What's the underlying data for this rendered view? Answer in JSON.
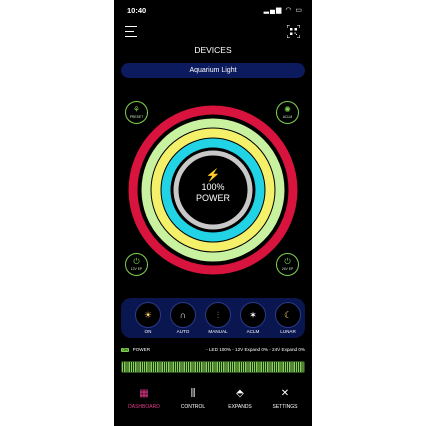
{
  "status": {
    "time": "10:40",
    "icons": "▂▄▆ ◠ ▭"
  },
  "header": {
    "title": "DEVICES",
    "device": "Aquarium Light"
  },
  "side_buttons": {
    "preset": {
      "label": "PRESET",
      "icon": "sprout-icon"
    },
    "aclm": {
      "label": "ACLM",
      "icon": "coral-icon"
    },
    "v12": {
      "label": "12V EP",
      "icon": "plug-icon"
    },
    "v24": {
      "label": "24V EP",
      "icon": "plug-icon"
    }
  },
  "center": {
    "glyph": "⚡",
    "power_value": "100%",
    "power_label": "POWER"
  },
  "rings": [
    {
      "color": "#d8133d"
    },
    {
      "color": "#c9f2a0"
    },
    {
      "color": "#f5f06a"
    },
    {
      "color": "#22d3e6"
    },
    {
      "color": "#c8c8c8"
    }
  ],
  "modes": [
    {
      "label": "ON",
      "glyph": "☀"
    },
    {
      "label": "AUTO",
      "glyph": "∩"
    },
    {
      "label": "MANUAL",
      "glyph": "⫶"
    },
    {
      "label": "ACLM",
      "glyph": "✶"
    },
    {
      "label": "LUNAR",
      "glyph": "☾"
    }
  ],
  "power_status": {
    "tag": "ON",
    "label": "POWER",
    "details": "- LED 100% - 12V Expand 0% - 24V Expand 0%"
  },
  "power_level": 1.0,
  "nav": [
    {
      "label": "DASHBOARD",
      "glyph": "▦",
      "active": true
    },
    {
      "label": "CONTROL",
      "glyph": "⫼",
      "active": false
    },
    {
      "label": "EXPANDS",
      "glyph": "⬘",
      "active": false
    },
    {
      "label": "SETTINGS",
      "glyph": "✕",
      "active": false
    }
  ],
  "colors": {
    "accent_active": "#e23a8b",
    "accent_green": "#7fd24f",
    "panel_blue": "#0a1650"
  }
}
